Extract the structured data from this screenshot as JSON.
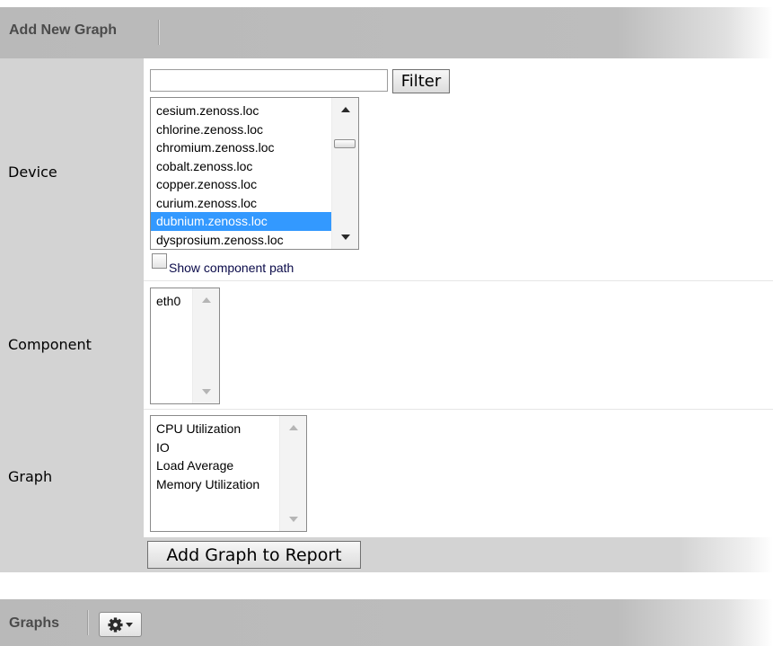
{
  "add_new_graph_panel": {
    "title": "Add New Graph"
  },
  "device_row": {
    "label": "Device",
    "filter": {
      "value": "",
      "button_label": "Filter"
    },
    "devices": [
      {
        "label": "cesium.zenoss.loc",
        "selected": false
      },
      {
        "label": "chlorine.zenoss.loc",
        "selected": false
      },
      {
        "label": "chromium.zenoss.loc",
        "selected": false
      },
      {
        "label": "cobalt.zenoss.loc",
        "selected": false
      },
      {
        "label": "copper.zenoss.loc",
        "selected": false
      },
      {
        "label": "curium.zenoss.loc",
        "selected": false
      },
      {
        "label": "dubnium.zenoss.loc",
        "selected": true
      },
      {
        "label": "dysprosium.zenoss.loc",
        "selected": false
      }
    ],
    "show_component_path": {
      "label": "Show component path",
      "checked": false
    }
  },
  "component_row": {
    "label": "Component",
    "components": [
      "eth0"
    ]
  },
  "graph_row": {
    "label": "Graph",
    "graphs": [
      "CPU Utilization",
      "IO",
      "Load Average",
      "Memory Utilization"
    ]
  },
  "actions": {
    "add_graph_label": "Add Graph to Report"
  },
  "graphs_panel": {
    "title": "Graphs",
    "gear_menu_icon": "gear-icon",
    "dropdown_icon": "caret-down-icon"
  },
  "colors": {
    "header_gray": "#bdbdbd",
    "label_column": "#d3d3d3",
    "selection_blue": "#3399ff"
  }
}
